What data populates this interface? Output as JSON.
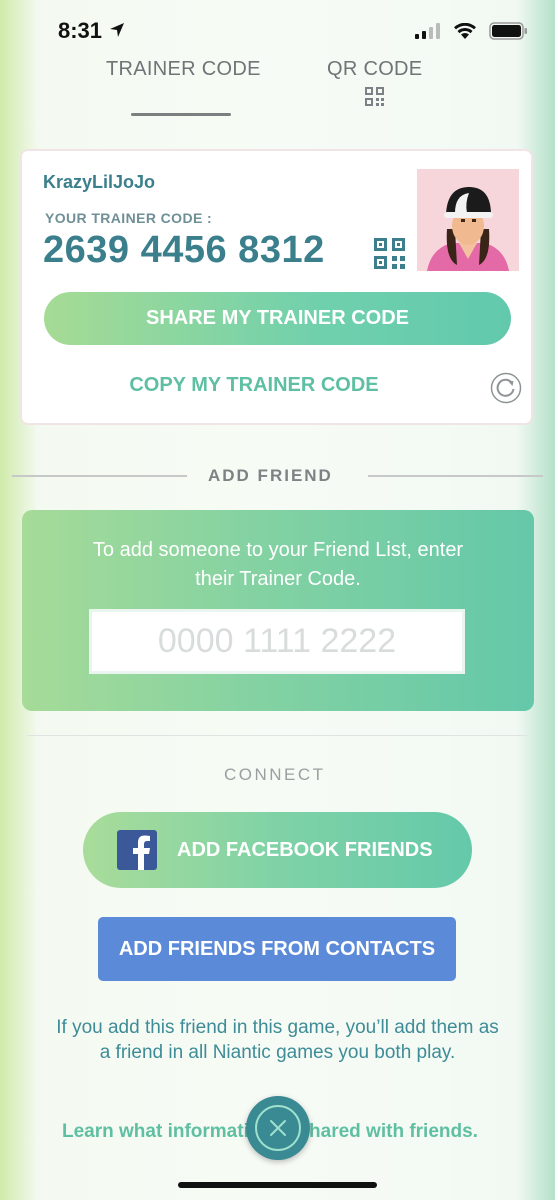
{
  "status_bar": {
    "time": "8:31"
  },
  "tabs": [
    {
      "label": "TRAINER CODE",
      "selected": true
    },
    {
      "label": "QR CODE",
      "selected": false,
      "icon": "qr-code-icon"
    }
  ],
  "trainer_card": {
    "username": "KrazyLilJoJo",
    "code_label": "YOUR TRAINER CODE :",
    "trainer_code": "2639 4456 8312",
    "share_label": "SHARE MY TRAINER CODE",
    "copy_label": "COPY MY TRAINER CODE"
  },
  "add_friend": {
    "title": "ADD FRIEND",
    "instruction": "To add someone to your Friend List, enter their Trainer Code.",
    "input_placeholder": "0000 1111 2222",
    "input_value": ""
  },
  "connect": {
    "title": "CONNECT",
    "facebook_label": "ADD FACEBOOK FRIENDS",
    "contacts_label": "ADD FRIENDS FROM CONTACTS"
  },
  "info_text": "If you add this friend in this game, you’ll add them as a friend in all Niantic games you both play.",
  "learn_more": "Learn what information is shared with friends.",
  "colors": {
    "teal_text": "#3b7f8c",
    "green_accent": "#5fbfa2",
    "contacts_blue": "#5b8ad8",
    "facebook_blue": "#3b5998"
  }
}
